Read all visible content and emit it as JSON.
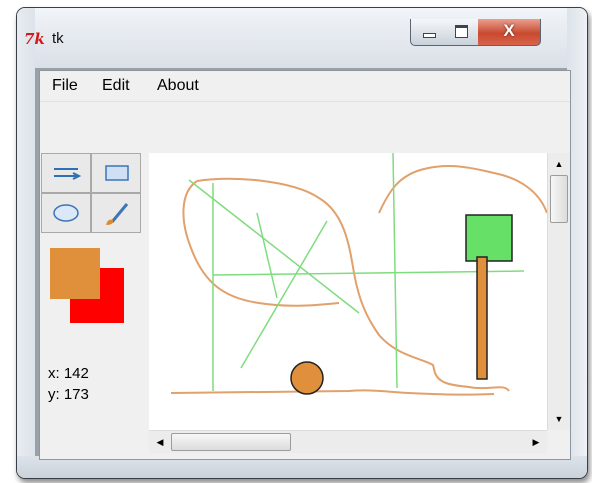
{
  "window": {
    "title": "tk",
    "icon": "tk-feather-icon",
    "icon_text": "7k"
  },
  "controls": {
    "minimize": "minimize-icon",
    "maximize": "maximize-icon",
    "close_label": "X"
  },
  "menu": {
    "items": [
      "File",
      "Edit",
      "About"
    ]
  },
  "tools": [
    {
      "name": "line-tool",
      "icon": "arrow-line-icon"
    },
    {
      "name": "rectangle-tool",
      "icon": "rectangle-icon"
    },
    {
      "name": "oval-tool",
      "icon": "oval-icon"
    },
    {
      "name": "brush-tool",
      "icon": "brush-icon"
    }
  ],
  "colors": {
    "primary": "#e0903a",
    "secondary": "#ff0000"
  },
  "coords": {
    "x_label": "x: 142",
    "y_label": "y: 173"
  },
  "canvas_colors": {
    "freehand": "#e2a06a",
    "lines": "#7fdc7f",
    "rect_fill": "#66e066",
    "bar_fill": "#e0903a",
    "circle_fill": "#e0903a",
    "outline": "#222222"
  }
}
